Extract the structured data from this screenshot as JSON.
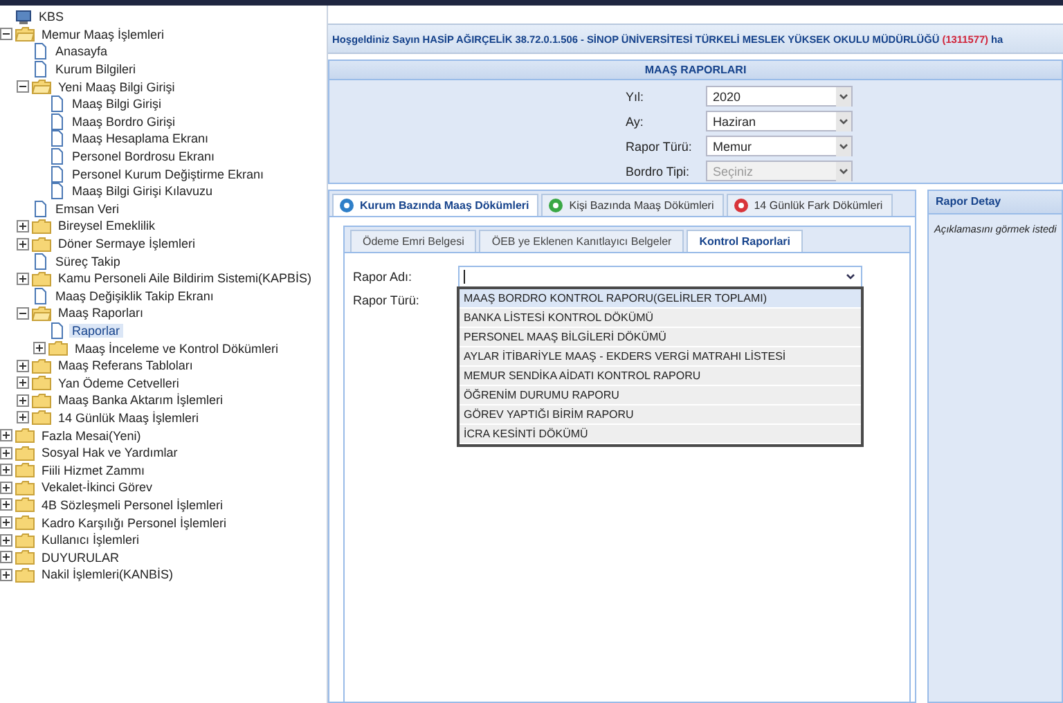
{
  "tree": [
    {
      "label": "KBS",
      "kind": "root",
      "selected": false,
      "children": [
        {
          "label": "Memur Maaş İşlemleri",
          "kind": "folder",
          "expanded": true,
          "selected": false,
          "children": [
            {
              "label": "Anasayfa",
              "kind": "page",
              "selected": false
            },
            {
              "label": "Kurum Bilgileri",
              "kind": "page",
              "selected": false
            },
            {
              "label": "Yeni Maaş Bilgi Girişi",
              "kind": "folder",
              "expanded": true,
              "selected": false,
              "children": [
                {
                  "label": "Maaş Bilgi Girişi",
                  "kind": "page",
                  "selected": false
                },
                {
                  "label": "Maaş Bordro Girişi",
                  "kind": "page",
                  "selected": false
                },
                {
                  "label": "Maaş Hesaplama Ekranı",
                  "kind": "page",
                  "selected": false
                },
                {
                  "label": "Personel Bordrosu Ekranı",
                  "kind": "page",
                  "selected": false
                },
                {
                  "label": "Personel Kurum Değiştirme Ekranı",
                  "kind": "page",
                  "selected": false
                },
                {
                  "label": "Maaş Bilgi Girişi Kılavuzu",
                  "kind": "page",
                  "selected": false
                }
              ]
            },
            {
              "label": "Emsan Veri",
              "kind": "page",
              "selected": false
            },
            {
              "label": "Bireysel Emeklilik",
              "kind": "folder",
              "expanded": false,
              "selected": false
            },
            {
              "label": "Döner Sermaye İşlemleri",
              "kind": "folder",
              "expanded": false,
              "selected": false
            },
            {
              "label": "Süreç Takip",
              "kind": "page",
              "selected": false
            },
            {
              "label": "Kamu Personeli Aile Bildirim Sistemi(KAPBİS)",
              "kind": "folder",
              "expanded": false,
              "selected": false
            },
            {
              "label": "Maaş Değişiklik Takip Ekranı",
              "kind": "page",
              "selected": false
            },
            {
              "label": "Maaş Raporları",
              "kind": "folder",
              "expanded": true,
              "selected": false,
              "children": [
                {
                  "label": "Raporlar",
                  "kind": "page",
                  "selected": true
                },
                {
                  "label": "Maaş İnceleme ve Kontrol Dökümleri",
                  "kind": "folder",
                  "expanded": false,
                  "selected": false
                }
              ]
            },
            {
              "label": "Maaş Referans Tabloları",
              "kind": "folder",
              "expanded": false,
              "selected": false
            },
            {
              "label": "Yan Ödeme Cetvelleri",
              "kind": "folder",
              "expanded": false,
              "selected": false
            },
            {
              "label": "Maaş Banka Aktarım İşlemleri",
              "kind": "folder",
              "expanded": false,
              "selected": false
            },
            {
              "label": "14 Günlük Maaş İşlemleri",
              "kind": "folder",
              "expanded": false,
              "selected": false
            }
          ]
        },
        {
          "label": "Fazla Mesai(Yeni)",
          "kind": "folder",
          "expanded": false,
          "selected": false
        },
        {
          "label": "Sosyal Hak ve Yardımlar",
          "kind": "folder",
          "expanded": false,
          "selected": false
        },
        {
          "label": "Fiili Hizmet Zammı",
          "kind": "folder",
          "expanded": false,
          "selected": false
        },
        {
          "label": "Vekalet-İkinci Görev",
          "kind": "folder",
          "expanded": false,
          "selected": false
        },
        {
          "label": "4B Sözleşmeli Personel İşlemleri",
          "kind": "folder",
          "expanded": false,
          "selected": false
        },
        {
          "label": "Kadro Karşılığı Personel İşlemleri",
          "kind": "folder",
          "expanded": false,
          "selected": false
        },
        {
          "label": "Kullanıcı İşlemleri",
          "kind": "folder",
          "expanded": false,
          "selected": false
        },
        {
          "label": "DUYURULAR",
          "kind": "folder",
          "expanded": false,
          "selected": false
        },
        {
          "label": "Nakil İşlemleri(KANBİS)",
          "kind": "folder",
          "expanded": false,
          "selected": false
        }
      ]
    }
  ],
  "welcome": {
    "text": "Hoşgeldiniz Sayın HASİP AĞIRÇELİK 38.72.0.1.506 - SİNOP ÜNİVERSİTESİ TÜRKELİ MESLEK YÜKSEK OKULU MÜDÜRLÜĞÜ",
    "code": "(1311577)",
    "tail": "ha"
  },
  "report_panel": {
    "title": "MAAŞ RAPORLARI",
    "fields": [
      {
        "label": "Yıl:",
        "value": "2020",
        "disabled": false
      },
      {
        "label": "Ay:",
        "value": "Haziran",
        "disabled": false
      },
      {
        "label": "Rapor Türü:",
        "value": "Memur",
        "disabled": false
      },
      {
        "label": "Bordro Tipi:",
        "placeholder": "Seçiniz",
        "disabled": true
      }
    ]
  },
  "tabs": [
    {
      "label": "Kurum Bazında Maaş Dökümleri",
      "selected": true,
      "color": "#2f7fc8"
    },
    {
      "label": "Kişi Bazında Maaş Dökümleri",
      "selected": false,
      "color": "#3aa845"
    },
    {
      "label": "14 Günlük Fark Dökümleri",
      "selected": false,
      "color": "#d8343a"
    }
  ],
  "subtabs": [
    {
      "label": "Ödeme Emri Belgesi",
      "selected": false
    },
    {
      "label": "ÖEB ye Eklenen Kanıtlayıcı Belgeler",
      "selected": false
    },
    {
      "label": "Kontrol Raporlari",
      "selected": true
    }
  ],
  "form": {
    "report_name_label": "Rapor Adı:",
    "report_type_label": "Rapor Türü:",
    "options": [
      {
        "label": "MAAŞ BORDRO KONTROL RAPORU(GELİRLER TOPLAMI)",
        "selected": true
      },
      {
        "label": "BANKA LİSTESİ KONTROL DÖKÜMÜ",
        "selected": false
      },
      {
        "label": "PERSONEL MAAŞ BİLGİLERİ DÖKÜMÜ",
        "selected": false
      },
      {
        "label": "AYLAR İTİBARİYLE MAAŞ - EKDERS VERGİ MATRAHI LİSTESİ",
        "selected": false
      },
      {
        "label": "MEMUR SENDİKA AİDATI KONTROL RAPORU",
        "selected": false
      },
      {
        "label": "ÖĞRENİM DURUMU RAPORU",
        "selected": false
      },
      {
        "label": "GÖREV YAPTIĞI BİRİM RAPORU",
        "selected": false
      },
      {
        "label": "İCRA KESİNTİ DÖKÜMÜ",
        "selected": false
      }
    ]
  },
  "detail": {
    "title": "Rapor Detay",
    "text": "Açıklamasını görmek istedi"
  }
}
